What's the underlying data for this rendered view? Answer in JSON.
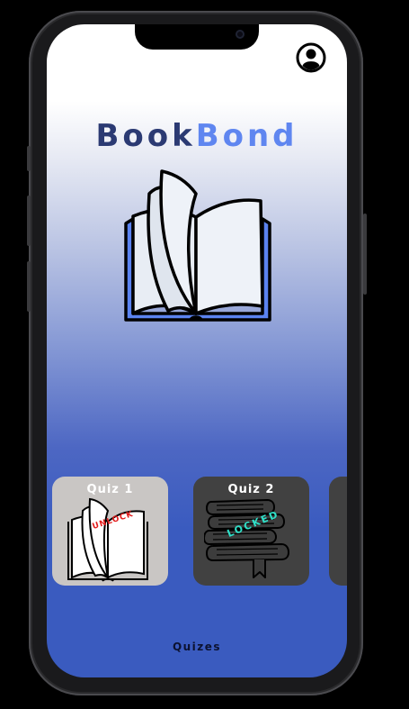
{
  "app": {
    "title_part1": "Book",
    "title_part2": "Bond"
  },
  "colors": {
    "title_dark": "#2b3a73",
    "title_light": "#5f86f0",
    "unlocked_card": "#c9c6c4",
    "locked_card": "#414141",
    "unlock_text": "#e21b1b",
    "locked_text": "#2fe0c8",
    "footer_text": "#0c1230"
  },
  "hero": {
    "icon": "open-book-icon"
  },
  "header": {
    "profile_icon": "user-profile-icon"
  },
  "quizzes": [
    {
      "label": "Quiz 1",
      "status_text": "UNLOCK",
      "icon": "open-book-icon",
      "locked": false
    },
    {
      "label": "Quiz 2",
      "status_text": "LOCKED",
      "icon": "book-stack-icon",
      "locked": true
    }
  ],
  "footer": {
    "label": "Quizes"
  }
}
